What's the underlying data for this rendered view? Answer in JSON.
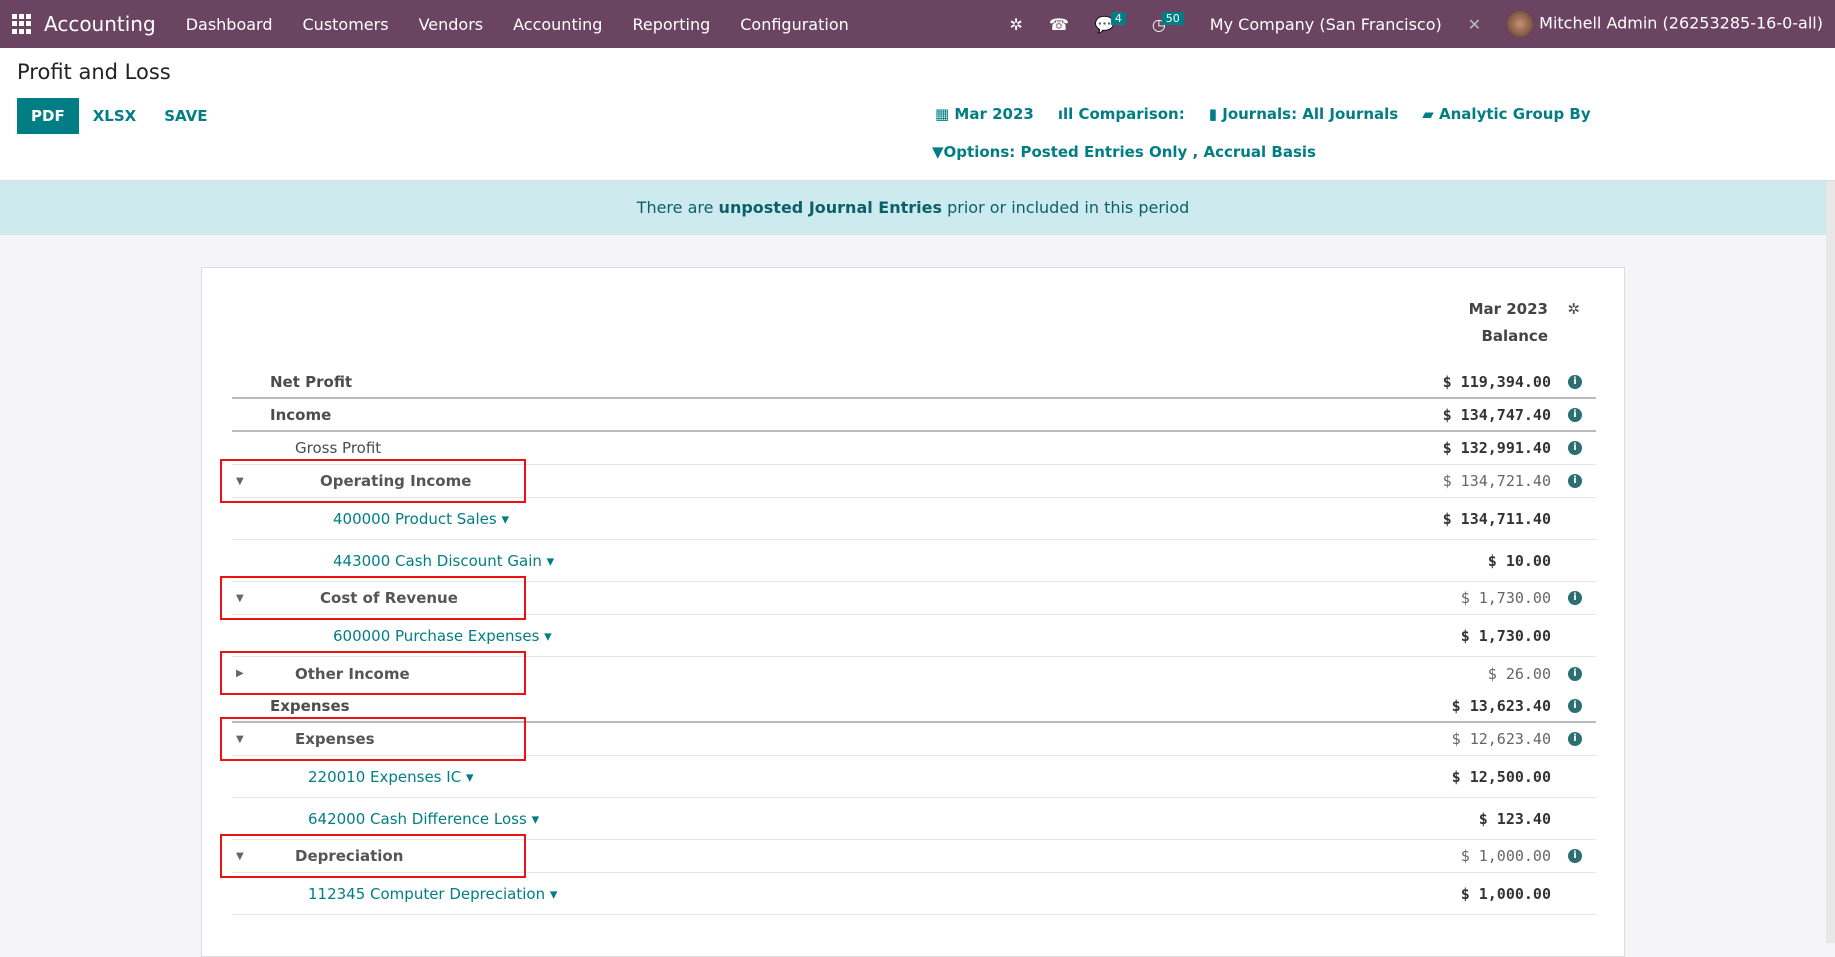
{
  "nav": {
    "brand": "Accounting",
    "menu": [
      "Dashboard",
      "Customers",
      "Vendors",
      "Accounting",
      "Reporting",
      "Configuration"
    ],
    "chat_count": "4",
    "activity_count": "50",
    "company": "My Company (San Francisco)",
    "user": "Mitchell Admin (26253285-16-0-all)"
  },
  "page": {
    "title": "Profit and Loss",
    "buttons": [
      "PDF",
      "XLSX",
      "SAVE"
    ]
  },
  "filters": {
    "date": "Mar 2023",
    "comparison": "Comparison:",
    "journals": "Journals: All Journals",
    "analytic": "Analytic Group By",
    "options": "Options: Posted Entries Only , Accrual Basis"
  },
  "banner": {
    "pre": "There are ",
    "bold": "unposted Journal Entries",
    "post": " prior or included in this period"
  },
  "report": {
    "col_period": "Mar 2023",
    "col_label": "Balance",
    "rows": [
      {
        "label": "Net Profit",
        "value": "$ 119,394.00",
        "kind": "total"
      },
      {
        "label": "Income",
        "value": "$ 134,747.40",
        "kind": "total"
      },
      {
        "label": "Gross Profit",
        "value": "$ 132,991.40",
        "kind": "sub"
      },
      {
        "label": "Operating Income",
        "value": "$ 134,721.40",
        "kind": "group",
        "caret": "down"
      },
      {
        "label": "400000 Product Sales",
        "value": "$ 134,711.40",
        "kind": "acct"
      },
      {
        "label": "443000 Cash Discount Gain",
        "value": "$ 10.00",
        "kind": "acct"
      },
      {
        "label": "Cost of Revenue",
        "value": "$ 1,730.00",
        "kind": "group",
        "caret": "down"
      },
      {
        "label": "600000 Purchase Expenses",
        "value": "$ 1,730.00",
        "kind": "acct"
      },
      {
        "label": "Other Income",
        "value": "$ 26.00",
        "kind": "group2",
        "caret": "right"
      },
      {
        "label": "Expenses",
        "value": "$ 13,623.40",
        "kind": "total"
      },
      {
        "label": "Expenses",
        "value": "$ 12,623.40",
        "kind": "group2",
        "caret": "down"
      },
      {
        "label": "220010 Expenses IC",
        "value": "$ 12,500.00",
        "kind": "acct2"
      },
      {
        "label": "642000 Cash Difference Loss",
        "value": "$ 123.40",
        "kind": "acct2"
      },
      {
        "label": "Depreciation",
        "value": "$ 1,000.00",
        "kind": "group2",
        "caret": "down"
      },
      {
        "label": "112345 Computer Depreciation",
        "value": "$ 1,000.00",
        "kind": "acct2"
      }
    ]
  }
}
